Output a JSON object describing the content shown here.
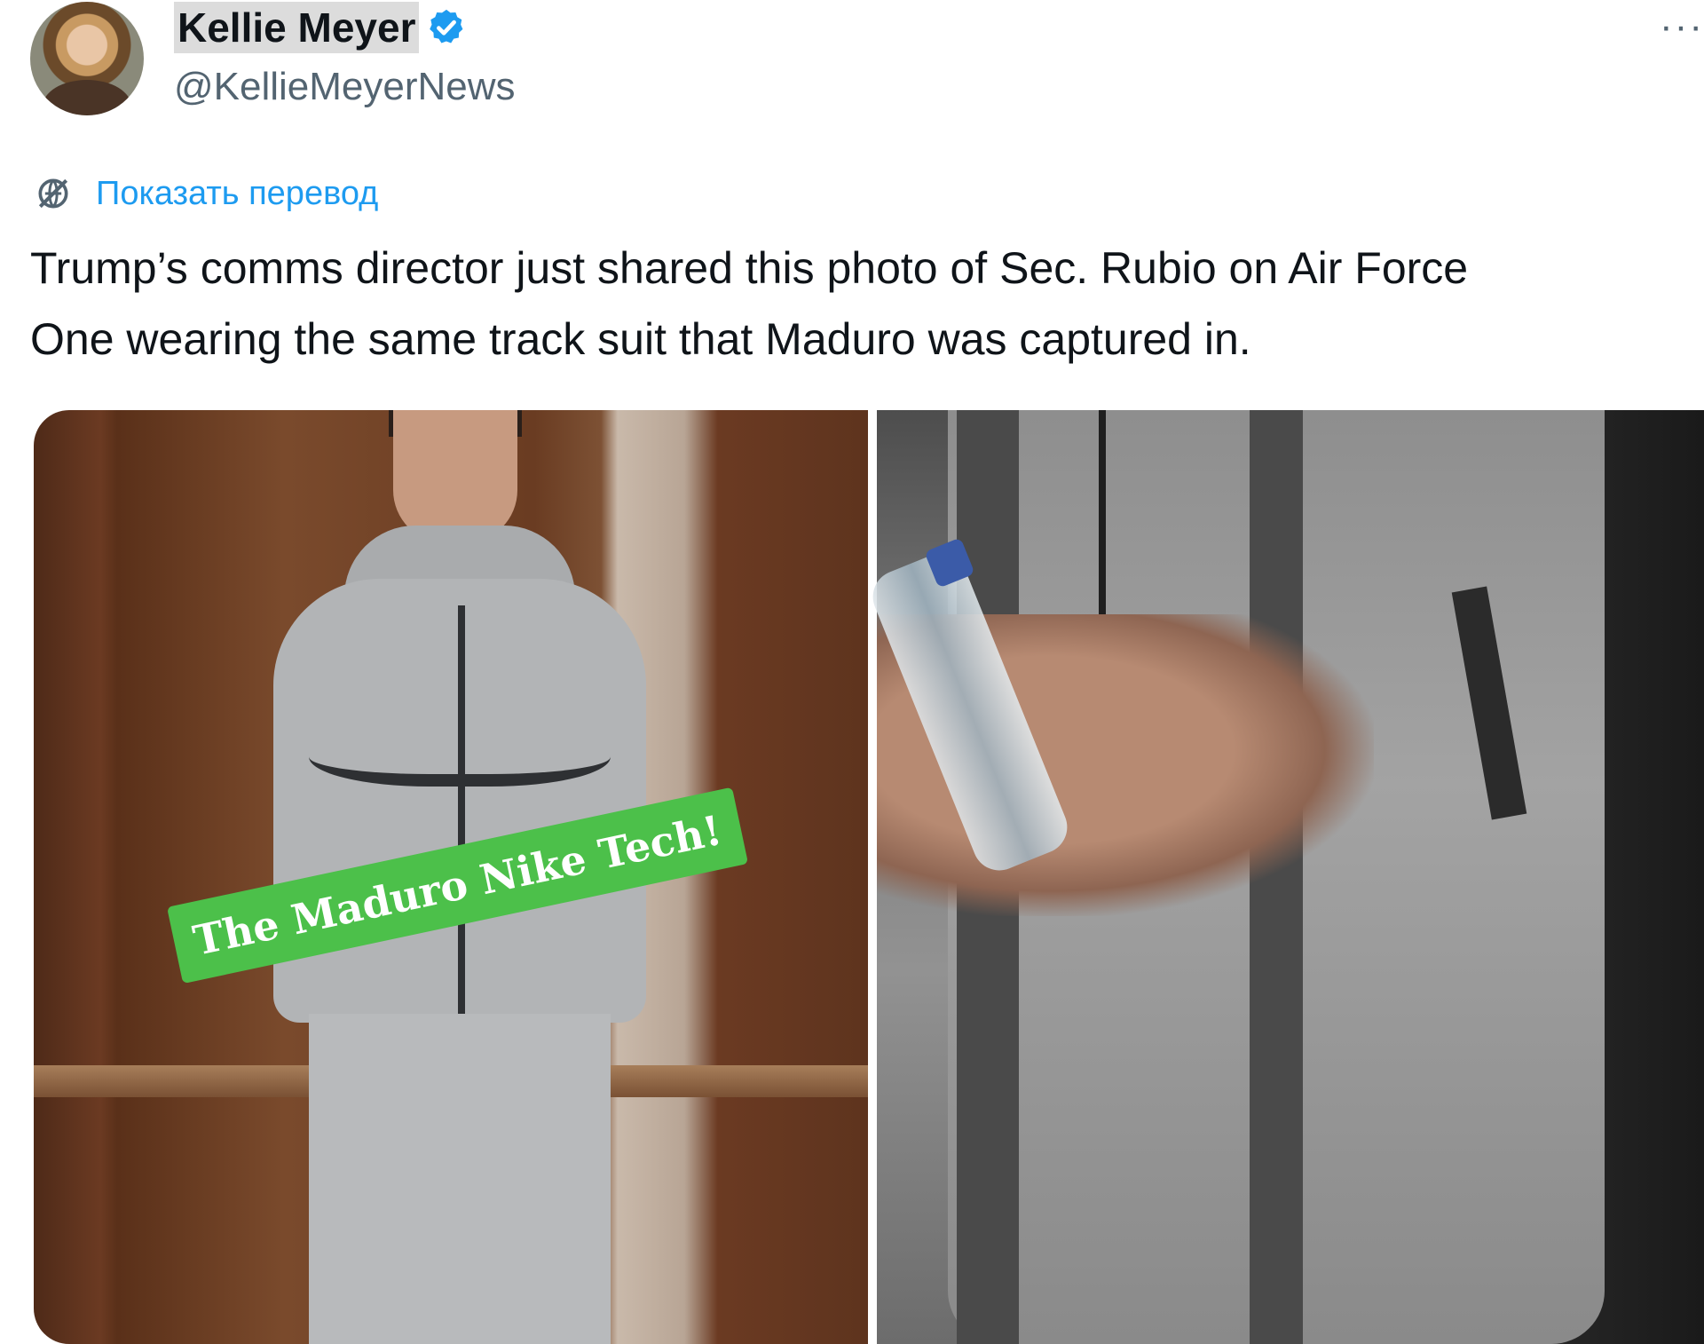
{
  "author": {
    "name": "Kellie Meyer",
    "handle": "@KellieMeyerNews",
    "verified": true
  },
  "menu": {
    "more_label": "···"
  },
  "translate": {
    "label": "Показать перевод"
  },
  "tweet": {
    "text_line1": "Trump’s comms director just shared this photo of Sec. Rubio on Air Force",
    "text_line2": "One wearing the same track suit that Maduro was captured in."
  },
  "media": {
    "left_photo": {
      "sticker_text": "The Maduro Nike Tech!"
    }
  },
  "colors": {
    "accent": "#1d9bf0",
    "secondary_text": "#536471",
    "sticker_green": "#4cc04a"
  },
  "icons": {
    "verified": "verified-badge-icon",
    "translate": "globe-icon",
    "more": "more-horizontal-icon"
  }
}
